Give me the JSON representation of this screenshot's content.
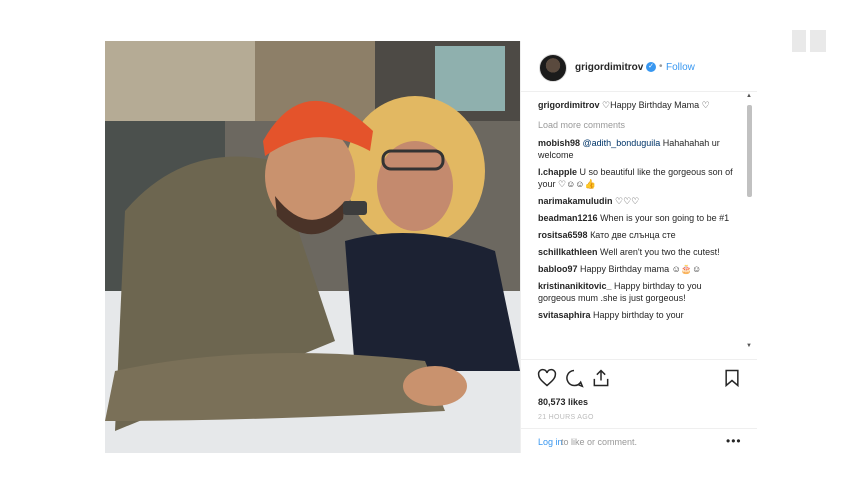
{
  "post": {
    "username": "grigordimitrov",
    "follow_label": "Follow",
    "dot": "•",
    "caption": {
      "user": "grigordimitrov",
      "text": "♡Happy Birthday Mama ♡"
    },
    "load_more": "Load more comments",
    "comments": [
      {
        "user": "mobish98",
        "mention": "@adith_bonduguila",
        "text": " Hahahahah ur welcome"
      },
      {
        "user": "l.chapple",
        "text": "U so beautiful like the gorgeous son of your ♡☺☺👍"
      },
      {
        "user": "narimakamuludin",
        "text": "♡♡♡"
      },
      {
        "user": "beadman1216",
        "text": "When is your son going to be #1"
      },
      {
        "user": "rositsa6598",
        "text": "Като две слънца сте"
      },
      {
        "user": "schillkathleen",
        "text": "Well aren't you two the cutest!"
      },
      {
        "user": "babloo97",
        "text": "Happy Birthday mama ☺🎂☺"
      },
      {
        "user": "kristinanikitovic_",
        "text": "Happy birthday to you gorgeous mum .she is just gorgeous!"
      },
      {
        "user": "svitasaphira",
        "text": "Happy birthday to your"
      }
    ],
    "likes": "80,573 likes",
    "time_ago": "21 HOURS AGO",
    "login_label": "Log in",
    "login_rest": "to like or comment.",
    "more": "•••",
    "next_arrow": "›"
  },
  "icons": {
    "like": "heart-icon",
    "comment": "comment-icon",
    "share": "share-icon",
    "save": "bookmark-icon",
    "verified": "verified-badge-icon"
  },
  "colors": {
    "accent": "#3897f0",
    "text": "#262626",
    "muted": "#999999"
  }
}
